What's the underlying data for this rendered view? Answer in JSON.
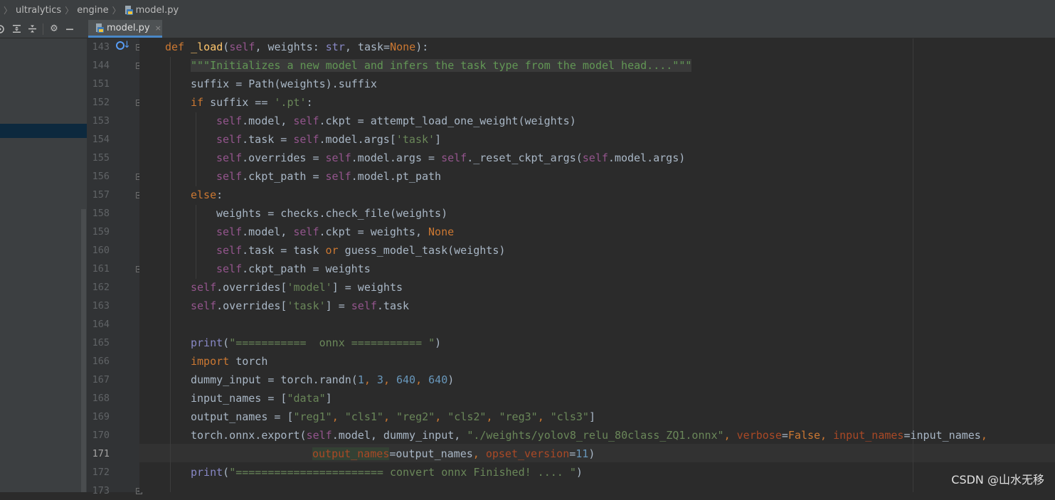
{
  "breadcrumb": {
    "items": [
      "ultralytics",
      "engine"
    ],
    "file": "model.py"
  },
  "toolbar": {
    "icons": [
      "target-icon",
      "expand-all-icon",
      "collapse-all-icon",
      "gear-icon",
      "minimize-icon"
    ]
  },
  "tab": {
    "label": "model.py",
    "close": "×"
  },
  "editor": {
    "current_line": "171",
    "colors": {
      "keyword": "#cc7832",
      "self": "#94558d",
      "string": "#6a8759",
      "number": "#6897bb",
      "docstring": "#629755",
      "function": "#ffc66d",
      "builtin": "#8888c6",
      "param": "#aa4926",
      "text": "#a9b7c6"
    },
    "lines": [
      {
        "num": "143",
        "tokens": [
          [
            "k",
            "def "
          ],
          [
            "f",
            "_load"
          ],
          [
            "t",
            "("
          ],
          [
            "s",
            "self"
          ],
          [
            "t",
            ", weights: "
          ],
          [
            "b",
            "str"
          ],
          [
            "t",
            ", task="
          ],
          [
            "k",
            "None"
          ],
          [
            "t",
            "):"
          ]
        ]
      },
      {
        "num": "144",
        "tokens": [
          [
            "d",
            "\"\"\"Initializes a new model and infers the task type from the model head....\"\"\""
          ]
        ]
      },
      {
        "num": "151",
        "tokens": [
          [
            "t",
            "suffix = Path(weights).suffix"
          ]
        ]
      },
      {
        "num": "152",
        "tokens": [
          [
            "k",
            "if "
          ],
          [
            "t",
            "suffix == "
          ],
          [
            "g",
            "'.pt'"
          ],
          [
            "t",
            ":"
          ]
        ]
      },
      {
        "num": "153",
        "tokens": [
          [
            "s",
            "self"
          ],
          [
            "t",
            ".model, "
          ],
          [
            "s",
            "self"
          ],
          [
            "t",
            ".ckpt = attempt_load_one_weight(weights)"
          ]
        ]
      },
      {
        "num": "154",
        "tokens": [
          [
            "s",
            "self"
          ],
          [
            "t",
            ".task = "
          ],
          [
            "s",
            "self"
          ],
          [
            "t",
            ".model.args["
          ],
          [
            "g",
            "'task'"
          ],
          [
            "t",
            "]"
          ]
        ]
      },
      {
        "num": "155",
        "tokens": [
          [
            "s",
            "self"
          ],
          [
            "t",
            ".overrides = "
          ],
          [
            "s",
            "self"
          ],
          [
            "t",
            ".model.args = "
          ],
          [
            "s",
            "self"
          ],
          [
            "t",
            "._reset_ckpt_args("
          ],
          [
            "s",
            "self"
          ],
          [
            "t",
            ".model.args)"
          ]
        ]
      },
      {
        "num": "156",
        "tokens": [
          [
            "s",
            "self"
          ],
          [
            "t",
            ".ckpt_path = "
          ],
          [
            "s",
            "self"
          ],
          [
            "t",
            ".model.pt_path"
          ]
        ]
      },
      {
        "num": "157",
        "tokens": [
          [
            "k",
            "else"
          ],
          [
            "t",
            ":"
          ]
        ]
      },
      {
        "num": "158",
        "tokens": [
          [
            "t",
            "weights = checks.check_file(weights)"
          ]
        ]
      },
      {
        "num": "159",
        "tokens": [
          [
            "s",
            "self"
          ],
          [
            "t",
            ".model, "
          ],
          [
            "s",
            "self"
          ],
          [
            "t",
            ".ckpt = weights, "
          ],
          [
            "k",
            "None"
          ]
        ]
      },
      {
        "num": "160",
        "tokens": [
          [
            "s",
            "self"
          ],
          [
            "t",
            ".task = task "
          ],
          [
            "k",
            "or "
          ],
          [
            "t",
            "guess_model_task(weights)"
          ]
        ]
      },
      {
        "num": "161",
        "tokens": [
          [
            "s",
            "self"
          ],
          [
            "t",
            ".ckpt_path = weights"
          ]
        ]
      },
      {
        "num": "162",
        "tokens": [
          [
            "s",
            "self"
          ],
          [
            "t",
            ".overrides["
          ],
          [
            "g",
            "'model'"
          ],
          [
            "t",
            "] = weights"
          ]
        ]
      },
      {
        "num": "163",
        "tokens": [
          [
            "s",
            "self"
          ],
          [
            "t",
            ".overrides["
          ],
          [
            "g",
            "'task'"
          ],
          [
            "t",
            "] = "
          ],
          [
            "s",
            "self"
          ],
          [
            "t",
            ".task"
          ]
        ]
      },
      {
        "num": "164",
        "tokens": []
      },
      {
        "num": "165",
        "tokens": [
          [
            "b",
            "print"
          ],
          [
            "t",
            "("
          ],
          [
            "g",
            "\"===========  onnx =========== \""
          ],
          [
            "t",
            ")"
          ]
        ]
      },
      {
        "num": "166",
        "tokens": [
          [
            "k",
            "import "
          ],
          [
            "t",
            "torch"
          ]
        ]
      },
      {
        "num": "167",
        "tokens": [
          [
            "t",
            "dummy_input = torch.randn("
          ],
          [
            "n",
            "1"
          ],
          [
            "k",
            ", "
          ],
          [
            "n",
            "3"
          ],
          [
            "k",
            ", "
          ],
          [
            "n",
            "640"
          ],
          [
            "k",
            ", "
          ],
          [
            "n",
            "640"
          ],
          [
            "t",
            ")"
          ]
        ]
      },
      {
        "num": "168",
        "tokens": [
          [
            "t",
            "input_names = ["
          ],
          [
            "g",
            "\"data\""
          ],
          [
            "t",
            "]"
          ]
        ]
      },
      {
        "num": "169",
        "tokens": [
          [
            "t",
            "output_names = ["
          ],
          [
            "g",
            "\"reg1\""
          ],
          [
            "k",
            ", "
          ],
          [
            "g",
            "\"cls1\""
          ],
          [
            "k",
            ", "
          ],
          [
            "g",
            "\"reg2\""
          ],
          [
            "k",
            ", "
          ],
          [
            "g",
            "\"cls2\""
          ],
          [
            "k",
            ", "
          ],
          [
            "g",
            "\"reg3\""
          ],
          [
            "k",
            ", "
          ],
          [
            "g",
            "\"cls3\""
          ],
          [
            "t",
            "]"
          ]
        ]
      },
      {
        "num": "170",
        "tokens": [
          [
            "t",
            "torch.onnx.export("
          ],
          [
            "s",
            "self"
          ],
          [
            "t",
            ".model, dummy_input, "
          ],
          [
            "g",
            "\"./weights/yolov8_relu_80class_ZQ1.onnx\""
          ],
          [
            "k",
            ", "
          ],
          [
            "p",
            "verbose"
          ],
          [
            "t",
            "="
          ],
          [
            "k",
            "False"
          ],
          [
            "k",
            ", "
          ],
          [
            "p",
            "input_names"
          ],
          [
            "t",
            "=input_names"
          ],
          [
            "k",
            ","
          ]
        ]
      },
      {
        "num": "171",
        "tokens": [
          [
            "P",
            "output_names"
          ],
          [
            "t",
            "=output_names"
          ],
          [
            "k",
            ", "
          ],
          [
            "p",
            "opset_version"
          ],
          [
            "t",
            "="
          ],
          [
            "n",
            "11"
          ],
          [
            "t",
            ")"
          ]
        ]
      },
      {
        "num": "172",
        "tokens": [
          [
            "b",
            "print"
          ],
          [
            "t",
            "("
          ],
          [
            "g",
            "\"======================= convert onnx Finished! .... \""
          ],
          [
            "t",
            ")"
          ]
        ]
      },
      {
        "num": "173",
        "tokens": []
      }
    ]
  },
  "watermark": "CSDN @山水无移"
}
